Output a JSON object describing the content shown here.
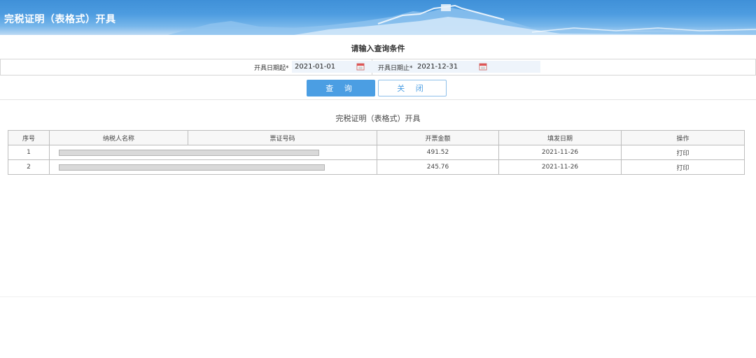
{
  "header": {
    "title": "完税证明（表格式）开具"
  },
  "query": {
    "title": "请输入查询条件",
    "start_label": "开具日期起*",
    "start_value": "2021-01-01",
    "end_label": "开具日期止*",
    "end_value": "2021-12-31",
    "query_button": "查 询",
    "close_button": "关 闭"
  },
  "results": {
    "title": "完税证明（表格式）开具",
    "columns": [
      "序号",
      "纳税人名称",
      "票证号码",
      "开票金额",
      "填发日期",
      "操作"
    ],
    "rows": [
      {
        "index": "1",
        "amount": "491.52",
        "date": "2021-11-26",
        "action": "打印"
      },
      {
        "index": "2",
        "amount": "245.76",
        "date": "2021-11-26",
        "action": "打印"
      }
    ]
  },
  "colors": {
    "header_blue": "#4d9ce0",
    "accent": "#4b9ee3"
  },
  "icons": [
    "calendar-icon"
  ]
}
